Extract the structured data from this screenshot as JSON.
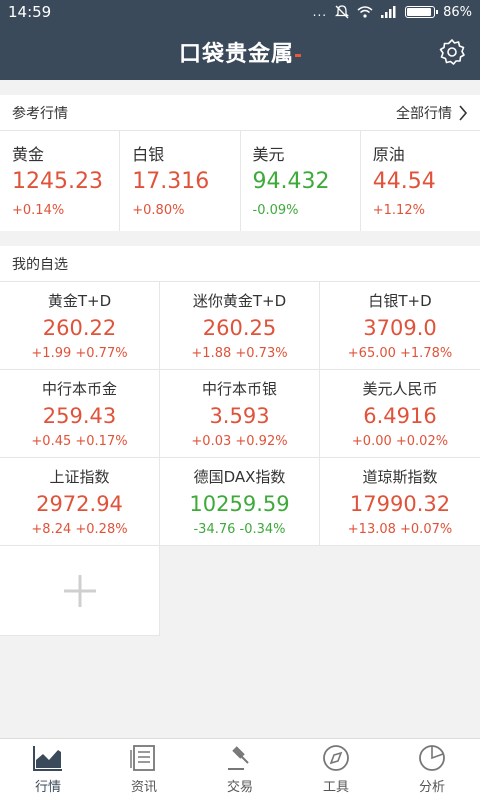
{
  "status": {
    "time": "14:59",
    "dots": "...",
    "battery_text": "86%",
    "battery_level": 0.86
  },
  "app": {
    "title": "口袋贵金属"
  },
  "reference": {
    "header": "参考行情",
    "all_link": "全部行情",
    "items": [
      {
        "name": "黄金",
        "price": "1245.23",
        "change": "+0.14%",
        "dir": "up"
      },
      {
        "name": "白银",
        "price": "17.316",
        "change": "+0.80%",
        "dir": "up"
      },
      {
        "name": "美元",
        "price": "94.432",
        "change": "-0.09%",
        "dir": "down"
      },
      {
        "name": "原油",
        "price": "44.54",
        "change": "+1.12%",
        "dir": "up"
      }
    ]
  },
  "watchlist": {
    "header": "我的自选",
    "items": [
      {
        "name": "黄金T+D",
        "price": "260.22",
        "change": "+1.99 +0.77%",
        "dir": "up"
      },
      {
        "name": "迷你黄金T+D",
        "price": "260.25",
        "change": "+1.88 +0.73%",
        "dir": "up"
      },
      {
        "name": "白银T+D",
        "price": "3709.0",
        "change": "+65.00 +1.78%",
        "dir": "up"
      },
      {
        "name": "中行本币金",
        "price": "259.43",
        "change": "+0.45 +0.17%",
        "dir": "up"
      },
      {
        "name": "中行本币银",
        "price": "3.593",
        "change": "+0.03 +0.92%",
        "dir": "up"
      },
      {
        "name": "美元人民币",
        "price": "6.4916",
        "change": "+0.00 +0.02%",
        "dir": "up"
      },
      {
        "name": "上证指数",
        "price": "2972.94",
        "change": "+8.24 +0.28%",
        "dir": "up"
      },
      {
        "name": "德国DAX指数",
        "price": "10259.59",
        "change": "-34.76 -0.34%",
        "dir": "down"
      },
      {
        "name": "道琼斯指数",
        "price": "17990.32",
        "change": "+13.08 +0.07%",
        "dir": "up"
      }
    ]
  },
  "nav": {
    "items": [
      {
        "label": "行情",
        "icon": "chart-icon"
      },
      {
        "label": "资讯",
        "icon": "news-icon"
      },
      {
        "label": "交易",
        "icon": "gavel-icon"
      },
      {
        "label": "工具",
        "icon": "compass-icon"
      },
      {
        "label": "分析",
        "icon": "pie-icon"
      }
    ]
  },
  "colors": {
    "header_bg": "#3b4a5a",
    "up": "#e0533a",
    "down": "#3daa3a",
    "accent": "#e35b3a"
  }
}
